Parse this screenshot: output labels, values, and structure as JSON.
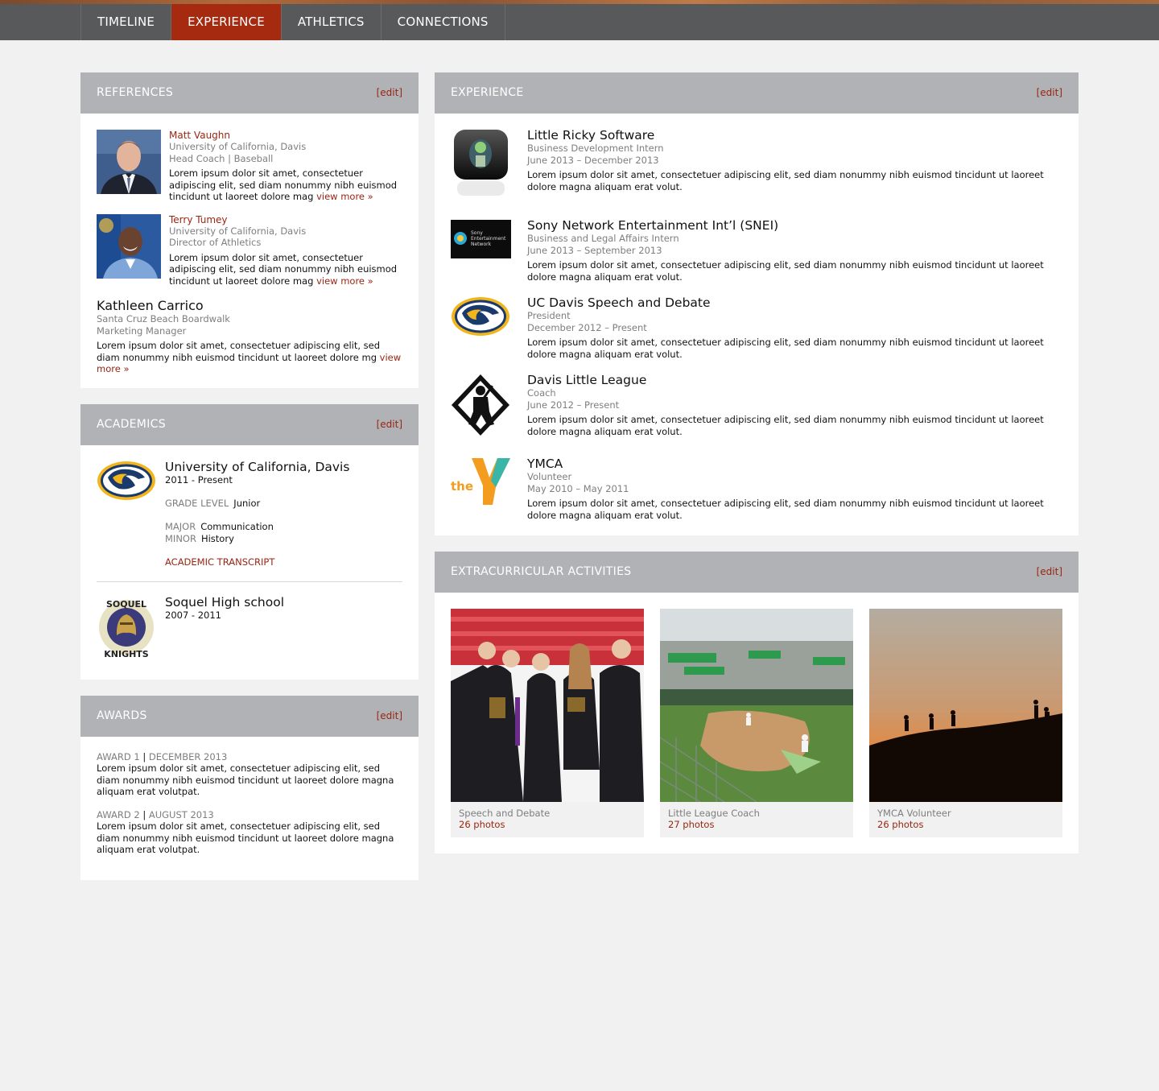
{
  "nav": {
    "tabs": [
      {
        "label": "TIMELINE"
      },
      {
        "label": "EXPERIENCE"
      },
      {
        "label": "ATHLETICS"
      },
      {
        "label": "CONNECTIONS"
      }
    ],
    "active_color": "#a52a0f"
  },
  "edit_label": "[edit]",
  "references": {
    "title": "REFERENCES",
    "items": [
      {
        "name": "Matt Vaughn",
        "org": "University of California, Davis",
        "role": "Head Coach | Baseball",
        "text": "Lorem ipsum dolor sit amet, consectetuer adipiscing elit, sed diam nonummy nibh euismod tincidunt ut laoreet dolore mag ",
        "more": "view more »"
      },
      {
        "name": "Terry Tumey",
        "org": "University of California, Davis",
        "role": "Director of Athletics",
        "text": "Lorem ipsum dolor sit amet, consectetuer adipiscing elit, sed diam nonummy nibh euismod tincidunt ut laoreet dolore mag ",
        "more": "view more »"
      },
      {
        "name": "Kathleen Carrico",
        "org": "Santa Cruz Beach Boardwalk",
        "role": "Marketing Manager",
        "text": "Lorem ipsum dolor sit amet, consectetuer adipiscing elit, sed diam nonummy nibh euismod tincidunt ut laoreet dolore mg ",
        "more": "view more »"
      }
    ]
  },
  "academics": {
    "title": "ACADEMICS",
    "schools": [
      {
        "name": "University of California, Davis",
        "years": "2011 - Present"
      },
      {
        "name": "Soquel High school",
        "years": "2007 - 2011",
        "logo_text_top": "SOQUEL",
        "logo_text_bottom": "KNIGHTS"
      }
    ],
    "grade_label": "GRADE LEVEL",
    "grade_value": "Junior",
    "major_label": "MAJOR",
    "major_value": "Communication",
    "minor_label": "MINOR",
    "minor_value": "History",
    "transcript_label": "ACADEMIC TRANSCRIPT"
  },
  "awards": {
    "title": "AWARDS",
    "items": [
      {
        "name": "AWARD 1",
        "sep": "|",
        "date": "DECEMBER 2013",
        "text": "Lorem ipsum dolor sit amet, consectetuer adipiscing elit, sed diam nonummy nibh euismod tincidunt ut laoreet dolore magna aliquam erat volutpat."
      },
      {
        "name": "AWARD 2",
        "sep": "|",
        "date": "AUGUST 2013",
        "text": "Lorem ipsum dolor sit amet, consectetuer adipiscing elit, sed diam nonummy nibh euismod tincidunt ut laoreet dolore magna aliquam erat volutpat."
      }
    ]
  },
  "experience": {
    "title": "EXPERIENCE",
    "items": [
      {
        "company": "Little Ricky Software",
        "role": "Business Development Intern",
        "dates": "June 2013 – December 2013",
        "desc": "Lorem ipsum dolor sit amet, consectetuer adipiscing elit, sed diam nonummy nibh euismod tincidunt ut laoreet dolore magna aliquam erat volut."
      },
      {
        "company": "Sony Network Entertainment Int’l (SNEI)",
        "role": "Business and Legal Affairs Intern",
        "dates": "June 2013 – September 2013",
        "desc": "Lorem ipsum dolor sit amet, consectetuer adipiscing elit, sed diam nonummy nibh euismod tincidunt ut laoreet dolore magna aliquam erat volut.",
        "logo_text": "Sony Entertainment Network"
      },
      {
        "company": "UC Davis Speech and Debate",
        "role": "President",
        "dates": "December 2012 – Present",
        "desc": "Lorem ipsum dolor sit amet, consectetuer adipiscing elit, sed diam nonummy nibh euismod tincidunt ut laoreet dolore magna aliquam erat volut."
      },
      {
        "company": "Davis Little League",
        "role": "Coach",
        "dates": "June 2012 – Present",
        "desc": "Lorem ipsum dolor sit amet, consectetuer adipiscing elit, sed diam nonummy nibh euismod tincidunt ut laoreet dolore magna aliquam erat volut."
      },
      {
        "company": "YMCA",
        "role": "Volunteer",
        "dates": "May 2010 – May 2011",
        "desc": "Lorem ipsum dolor sit amet, consectetuer adipiscing elit, sed diam nonummy nibh euismod tincidunt ut laoreet dolore magna aliquam erat volut.",
        "logo_text": "the"
      }
    ]
  },
  "extracurricular": {
    "title": "EXTRACURRICULAR ACTIVITIES",
    "items": [
      {
        "title": "Speech and Debate",
        "count": "26 photos"
      },
      {
        "title": "Little League Coach",
        "count": "27 photos"
      },
      {
        "title": "YMCA Volunteer",
        "count": "26 photos"
      }
    ]
  }
}
